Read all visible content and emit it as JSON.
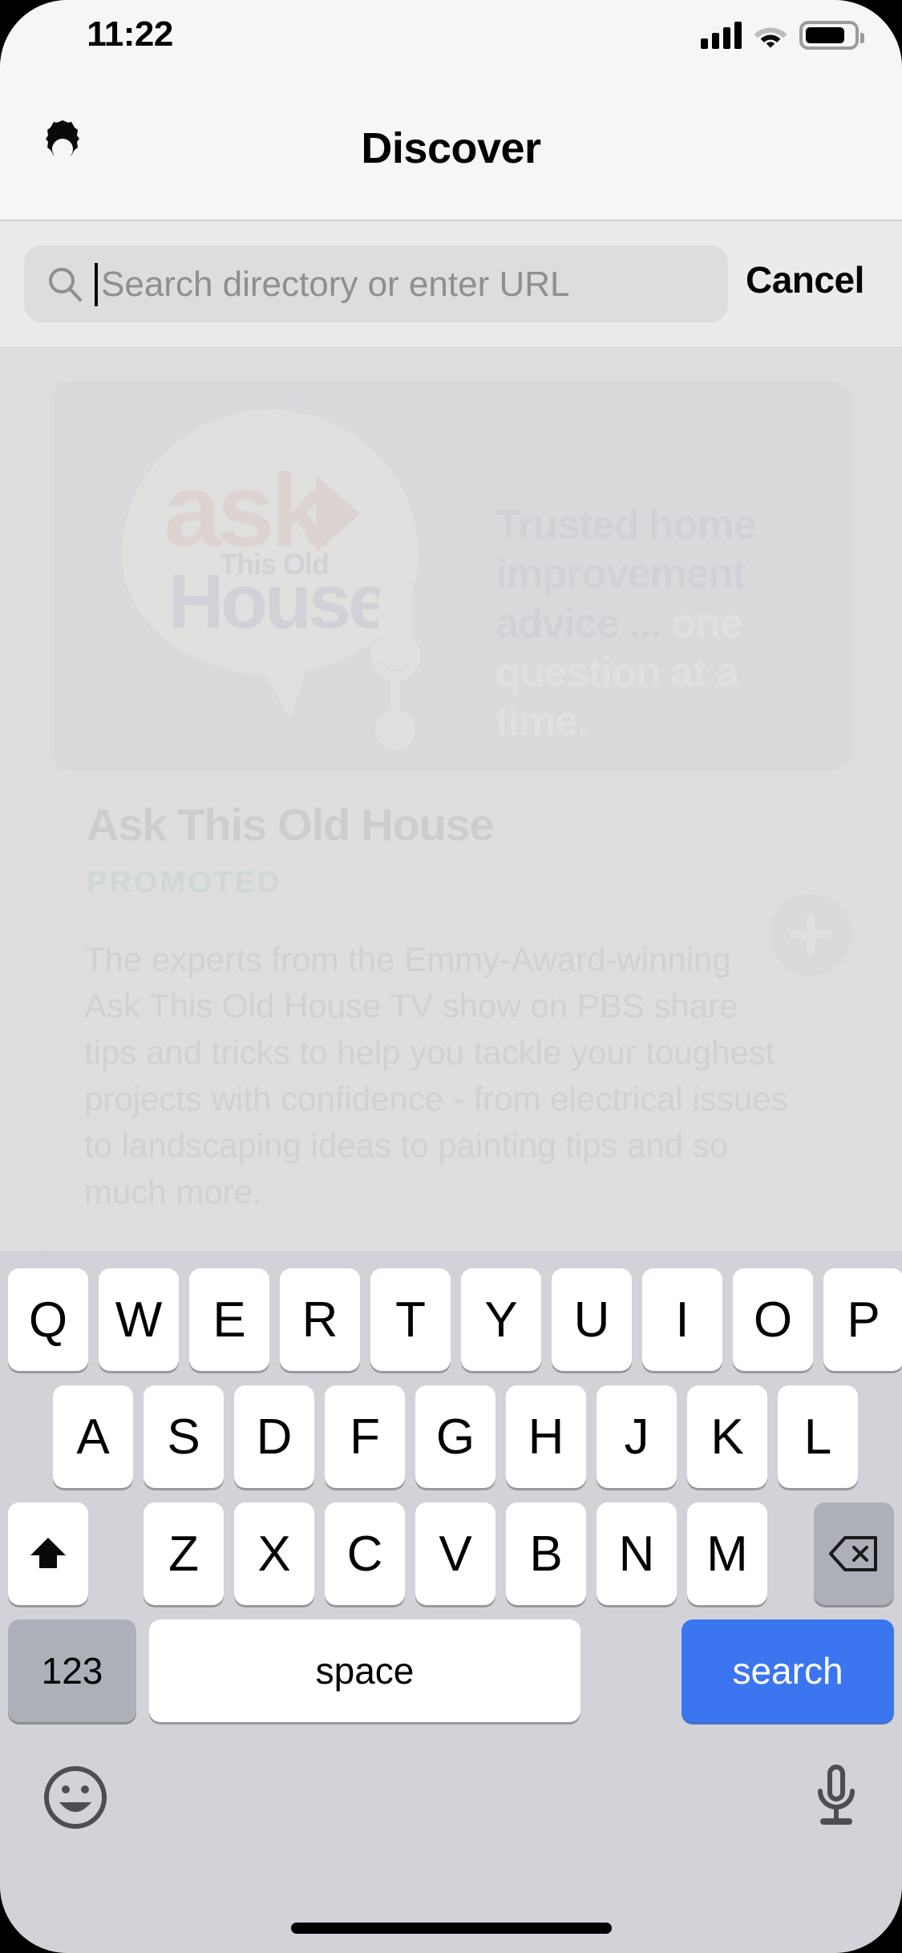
{
  "status_bar": {
    "time": "11:22",
    "cellular_icon": "cellular-signal-icon",
    "wifi_icon": "wifi-icon",
    "battery_icon": "battery-icon",
    "battery_level": "73%"
  },
  "nav_bar": {
    "settings_icon": "gear-icon",
    "title": "Discover"
  },
  "search_bar": {
    "icon": "search-icon",
    "value": "",
    "placeholder": "Search directory or enter URL",
    "cancel_label": "Cancel"
  },
  "content": {
    "hero": {
      "logo_word_1": "ask",
      "logo_word_2": "This Old",
      "logo_word_3": "House",
      "arrow_icon": "play-arrow-icon",
      "mic_icon": "microphone-icon",
      "tagline_part_1": "Trusted home improvement advice ... ",
      "tagline_part_2": "one question at a time."
    },
    "card": {
      "title": "Ask This Old House",
      "badge": "PROMOTED",
      "description": "The experts from the Emmy-Award-winning Ask This Old House TV show on PBS share tips and tricks to help you tackle your toughest projects with confidence - from electrical issues to landscaping ideas to painting tips and so much more.",
      "add_icon": "plus-circle-icon"
    }
  },
  "keyboard": {
    "row1": [
      "Q",
      "W",
      "E",
      "R",
      "T",
      "Y",
      "U",
      "I",
      "O",
      "P"
    ],
    "row2": [
      "A",
      "S",
      "D",
      "F",
      "G",
      "H",
      "J",
      "K",
      "L"
    ],
    "row3": [
      "Z",
      "X",
      "C",
      "V",
      "B",
      "N",
      "M"
    ],
    "shift_icon": "shift-up-arrow-icon",
    "backspace_icon": "backspace-delete-icon",
    "numeric_label": "123",
    "space_label": "space",
    "return_label": "search",
    "emoji_icon": "emoji-smiley-icon",
    "dictation_icon": "microphone-icon"
  },
  "colors": {
    "accent_blue": "#3b76f0",
    "keyboard_bg": "#d1d3d9",
    "key_white": "#ffffff",
    "key_grey": "#adb0b8",
    "promoted_green": "#2f9e8f",
    "logo_red": "#d96a5c",
    "logo_navy": "#4f5a8e"
  }
}
